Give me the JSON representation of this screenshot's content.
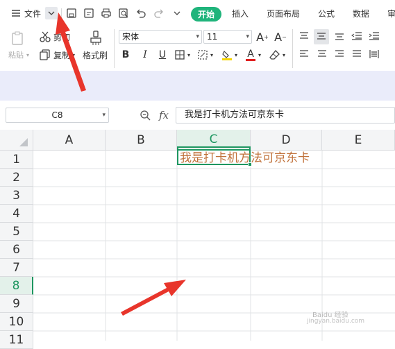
{
  "menu": {
    "file_label": "文件",
    "tabs": [
      "开始",
      "插入",
      "页面布局",
      "公式",
      "数据",
      "审"
    ]
  },
  "ribbon": {
    "paste_label": "粘贴",
    "cut_label": "剪切",
    "copy_label": "复制",
    "format_painter_label": "格式刷",
    "font_name": "宋体",
    "font_size": "11"
  },
  "formula_bar": {
    "name_box": "C8",
    "fx_label": "fx",
    "content": "我是打卡机方法可京东卡"
  },
  "sheet": {
    "columns": [
      "A",
      "B",
      "C",
      "D",
      "E"
    ],
    "rows": [
      "1",
      "2",
      "3",
      "4",
      "5",
      "6",
      "7",
      "8",
      "9",
      "10",
      "11"
    ],
    "selected_column": "C",
    "selected_row": "8",
    "c8_value": "我是打卡机方法可京东卡",
    "text_color": "#c0713a"
  },
  "colors": {
    "accent": "#1fb47b",
    "selection": "#1d9660",
    "arrow": "#e8352b"
  },
  "watermark": {
    "line1": "Baidu 经验",
    "line2": "jingyan.baidu.com"
  }
}
